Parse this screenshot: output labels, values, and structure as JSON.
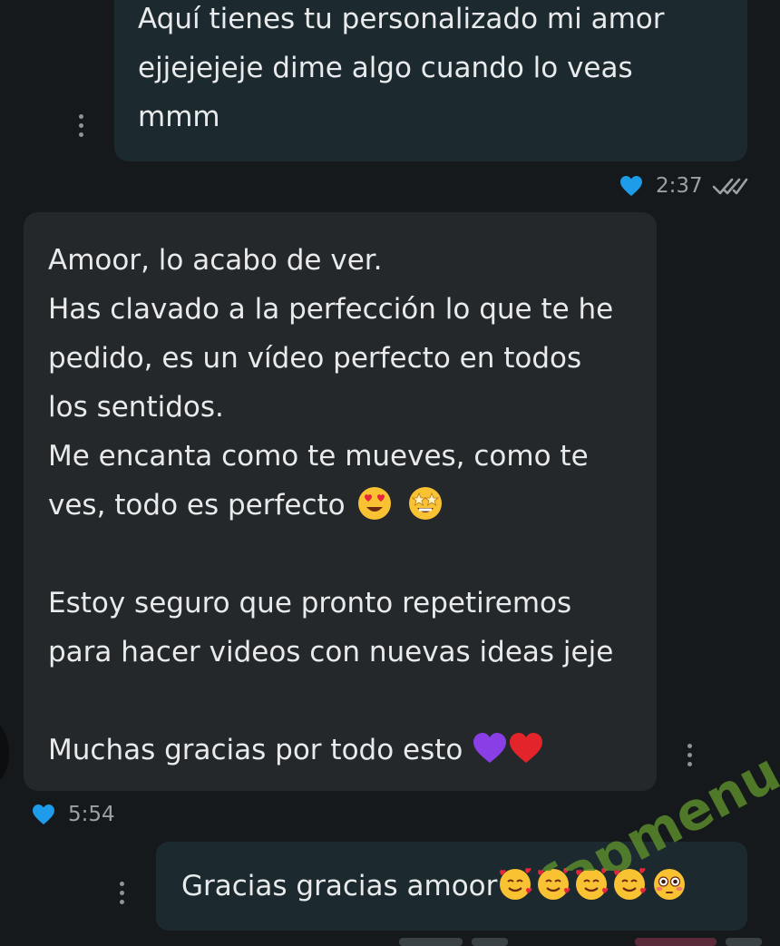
{
  "messages": [
    {
      "direction": "outgoing",
      "lines": [
        "Aquí tienes tu personalizado mi amor",
        "ejjejejeje dime algo cuando lo veas",
        "mmm"
      ],
      "time": "2:37",
      "reaction": "blue-heart",
      "status": "read-double-check"
    },
    {
      "direction": "incoming",
      "lines": [
        "Amoor, lo acabo de ver.",
        "Has clavado a la perfección lo que te he",
        "pedido, es un vídeo perfecto en todos",
        "los sentidos.",
        "Me encanta como te mueves, como te",
        "ves, todo es perfecto",
        "",
        "Estoy seguro que pronto repetiremos",
        "para hacer videos con nuevas ideas jeje",
        "",
        "Muchas gracias por todo esto"
      ],
      "time": "5:54",
      "reaction": "blue-heart"
    },
    {
      "direction": "outgoing",
      "text": "Gracias gracias amoor"
    }
  ],
  "watermark": "fapmenu.com",
  "colors": {
    "background": "#16191b",
    "outgoing_bubble": "#1c2a30",
    "incoming_bubble": "#24282b",
    "text": "#e8eaeb",
    "meta_text": "#9aa1a5",
    "reaction_heart": "#1e9be9",
    "watermark": "#5a8a2c"
  },
  "icons": [
    "blue-heart-icon",
    "double-check-icon",
    "more-vert-icon",
    "heart-eyes-emoji",
    "star-struck-emoji",
    "purple-heart-emoji",
    "red-heart-emoji",
    "smiling-face-with-hearts-emoji",
    "flushed-face-emoji"
  ]
}
